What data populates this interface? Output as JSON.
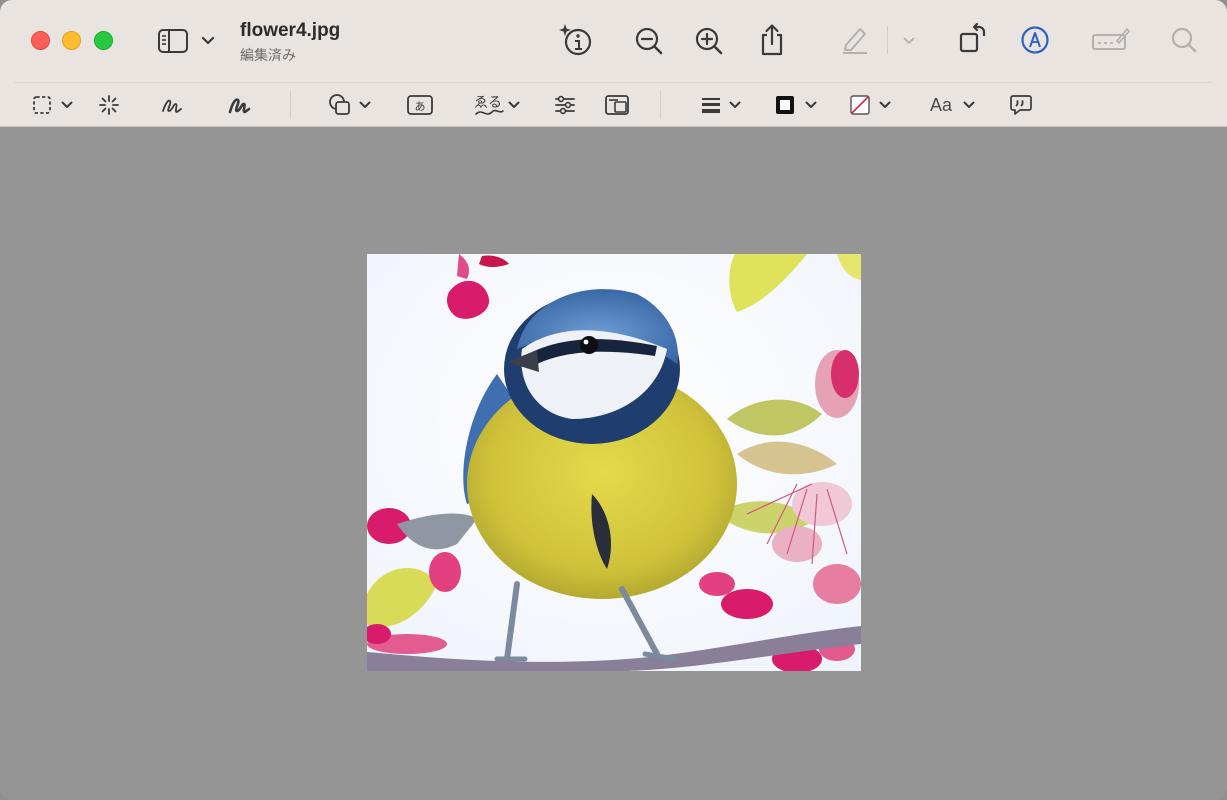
{
  "window": {
    "title": "flower4.jpg",
    "subtitle": "編集済み"
  },
  "toolbar": {
    "sidebar_icon": "sidebar-icon",
    "info_icon": "info-sparkle-icon",
    "zoom_out_icon": "zoom-out-icon",
    "zoom_in_icon": "zoom-in-icon",
    "share_icon": "share-icon",
    "highlight_icon": "highlighter-icon",
    "rotate_icon": "rotate-icon",
    "markup_icon": "markup-pen-icon",
    "signature_icon": "signature-box-icon",
    "search_icon": "search-icon",
    "markup_accent": "#2a63c6"
  },
  "markup_bar": {
    "text_style_label": "Aa",
    "sketch_box_text": "あ",
    "sign_text": "ゑる"
  },
  "photo": {
    "subject": "blue-tit-bird",
    "colors": {
      "bird_blue": "#3f6faf",
      "bird_yellow": "#d8cf3f",
      "flower_pink": "#d81b6a",
      "leaf_yellow": "#dfe25a",
      "branch": "#8a7f99"
    }
  }
}
